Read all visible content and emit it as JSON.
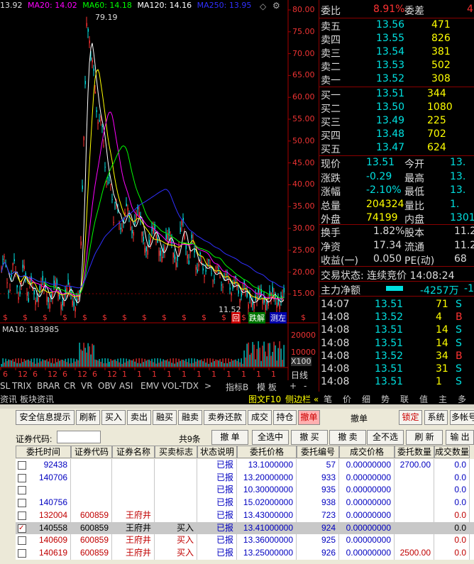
{
  "legend": {
    "open": "13.92",
    "ma20": "MA20: 14.02",
    "ma60": "MA60: 14.18",
    "ma120": "MA120: 14.16",
    "ma250": "MA250: 13.95"
  },
  "price_axis": [
    "80.00",
    "75.00",
    "70.00",
    "65.00",
    "60.00",
    "55.00",
    "50.00",
    "45.00",
    "40.00",
    "35.00",
    "30.00",
    "25.00",
    "20.00",
    "15.00"
  ],
  "peak_label": "79.19",
  "low_label": "11.52",
  "chart_tags": {
    "hui": "回",
    "dieji": "跌解",
    "ce": "测左"
  },
  "volume": {
    "label": "MA10: 183985",
    "axis": [
      "20000",
      "10000"
    ],
    "unit": "X100"
  },
  "date_labels": [
    "6",
    "12",
    "6",
    "12",
    "6",
    "12",
    "6",
    "12",
    "1",
    "1",
    "1",
    "1",
    "1",
    "1",
    "1",
    "1",
    "1",
    "1",
    "1"
  ],
  "tabs": [
    "SL",
    "TRIX",
    "BRAR",
    "CR",
    "VR",
    "OBV",
    "ASI",
    "EMV",
    "VOL-TDX",
    ">",
    "指标B",
    "模 板",
    "+",
    "-"
  ],
  "rizhu": "日线",
  "bottom_tabs": [
    "资讯",
    "板块资讯"
  ],
  "bottom_right": [
    "图文F10",
    "侧边栏 «",
    "笔",
    "价",
    "细",
    "势",
    "联",
    "值",
    "主",
    "多"
  ],
  "quote": {
    "weibi_label": "委比",
    "weibi_val": "8.91%",
    "weicha_label": "委差",
    "weicha_val": "4",
    "asks": [
      {
        "label": "卖五",
        "price": "13.56",
        "vol": "471"
      },
      {
        "label": "卖四",
        "price": "13.55",
        "vol": "826"
      },
      {
        "label": "卖三",
        "price": "13.54",
        "vol": "381"
      },
      {
        "label": "卖二",
        "price": "13.53",
        "vol": "502"
      },
      {
        "label": "卖一",
        "price": "13.52",
        "vol": "308"
      }
    ],
    "bids": [
      {
        "label": "买一",
        "price": "13.51",
        "vol": "344"
      },
      {
        "label": "买二",
        "price": "13.50",
        "vol": "1080"
      },
      {
        "label": "买三",
        "price": "13.49",
        "vol": "225"
      },
      {
        "label": "买四",
        "price": "13.48",
        "vol": "702"
      },
      {
        "label": "买五",
        "price": "13.47",
        "vol": "624"
      }
    ],
    "stats": [
      {
        "l1": "现价",
        "v1": "13.51",
        "l2": "今开",
        "v2": "13."
      },
      {
        "l1": "涨跌",
        "v1": "-0.29",
        "l2": "最高",
        "v2": "13."
      },
      {
        "l1": "涨幅",
        "v1": "-2.10%",
        "l2": "最低",
        "v2": "13."
      },
      {
        "l1": "总量",
        "v1": "204324",
        "l2": "量比",
        "v2": "1."
      },
      {
        "l1": "外盘",
        "v1": "74199",
        "l2": "内盘",
        "v2": "13013"
      }
    ],
    "stats2": [
      {
        "l1": "换手",
        "v1": "1.82%",
        "l2": "股本",
        "v2": "11.2"
      },
      {
        "l1": "净资",
        "v1": "17.34",
        "l2": "流通",
        "v2": "11.2"
      },
      {
        "l1": "收益(一)",
        "v1": "0.050",
        "l2": "PE(动)",
        "v2": "68"
      }
    ],
    "trade_status": "交易状态: 连续竞价 14:08:24",
    "zhuli_label": "主力净额",
    "zhuli_val": "-4257万",
    "zhuli_val2": "-15",
    "ticks": [
      {
        "t": "14:07",
        "p": "13.51",
        "v": "71",
        "s": "S"
      },
      {
        "t": "14:08",
        "p": "13.52",
        "v": "4",
        "s": "B"
      },
      {
        "t": "14:08",
        "p": "13.51",
        "v": "14",
        "s": "S"
      },
      {
        "t": "14:08",
        "p": "13.51",
        "v": "14",
        "s": "S"
      },
      {
        "t": "14:08",
        "p": "13.52",
        "v": "34",
        "s": "B"
      },
      {
        "t": "14:08",
        "p": "13.51",
        "v": "31",
        "s": "S"
      },
      {
        "t": "14:08",
        "p": "13.51",
        "v": "1",
        "s": "S"
      }
    ]
  },
  "trade": {
    "toolbar": [
      "安全信息提示",
      "刷新",
      "买入",
      "卖出",
      "融买",
      "融卖",
      "卖券还款",
      "成交",
      "持仓",
      "撤单"
    ],
    "panel_title": "撤单",
    "right_buttons": [
      "锁定",
      "系统",
      "多帐号"
    ],
    "code_label": "证券代码:",
    "count": "共9条",
    "action_buttons": [
      "撤 单",
      "全选中",
      "撤 买",
      "撤 卖",
      "全不选",
      "刷 新",
      "输 出"
    ],
    "headers": [
      "委托时间",
      "证券代码",
      "证券名称",
      "买卖标志",
      "状态说明",
      "委托价格",
      "委托编号",
      "成交价格",
      "委托数量",
      "成交数量"
    ],
    "rows": [
      {
        "time": "92438",
        "code": "",
        "name": "",
        "side": "",
        "status": "已报",
        "price": "13.1000000",
        "id": "57",
        "deal": "0.00000000",
        "qty": "2700.00",
        "dq": "0.0",
        "color": "#0000c0",
        "checked": false
      },
      {
        "time": "140706",
        "code": "",
        "name": "",
        "side": "",
        "status": "已报",
        "price": "13.20000000",
        "id": "933",
        "deal": "0.00000000",
        "qty": "",
        "dq": "0.0",
        "color": "#0000c0",
        "checked": false
      },
      {
        "time": "",
        "code": "",
        "name": "",
        "side": "",
        "status": "已报",
        "price": "10.30000000",
        "id": "935",
        "deal": "0.00000000",
        "qty": "",
        "dq": "0.0",
        "color": "#0000c0",
        "checked": false
      },
      {
        "time": "140756",
        "code": "",
        "name": "",
        "side": "",
        "status": "已报",
        "price": "15.02000000",
        "id": "938",
        "deal": "0.00000000",
        "qty": "",
        "dq": "0.0",
        "color": "#0000c0",
        "checked": false
      },
      {
        "time": "132004",
        "code": "600859",
        "name": "王府井",
        "side": "",
        "status": "已报",
        "price": "13.43000000",
        "id": "723",
        "deal": "0.00000000",
        "qty": "",
        "dq": "0.0",
        "color": "#c00000",
        "checked": false
      },
      {
        "time": "140558",
        "code": "600859",
        "name": "王府井",
        "side": "买入",
        "status": "已报",
        "price": "13.41000000",
        "id": "924",
        "deal": "0.00000000",
        "qty": "",
        "dq": "0.0",
        "color": "#000000",
        "checked": true
      },
      {
        "time": "140609",
        "code": "600859",
        "name": "王府井",
        "side": "买入",
        "status": "已报",
        "price": "13.36000000",
        "id": "925",
        "deal": "0.00000000",
        "qty": "",
        "dq": "0.0",
        "color": "#c00000",
        "checked": false
      },
      {
        "time": "140619",
        "code": "600859",
        "name": "王府井",
        "side": "买入",
        "status": "已报",
        "price": "13.25000000",
        "id": "926",
        "deal": "0.00000000",
        "qty": "2500.00",
        "dq": "0.0",
        "color": "#c00000",
        "checked": false
      }
    ]
  },
  "colors": {
    "up": "#ff3232",
    "down": "#00e0e0",
    "ma20": "#ff00ff",
    "ma60": "#00ff00",
    "ma120": "#ffffff",
    "ma250": "#3030ff",
    "yellow": "#ffff00"
  }
}
